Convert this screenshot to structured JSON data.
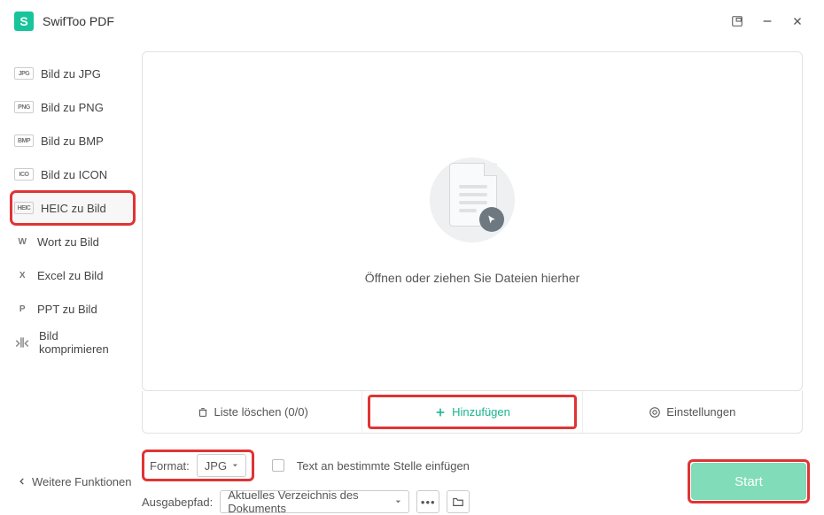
{
  "app": {
    "title": "SwifToo PDF"
  },
  "sidebar": {
    "items": [
      {
        "badge": "JPG",
        "label": "Bild zu JPG"
      },
      {
        "badge": "PNG",
        "label": "Bild zu PNG"
      },
      {
        "badge": "BMP",
        "label": "Bild zu BMP"
      },
      {
        "badge": "ICO",
        "label": "Bild zu ICON"
      },
      {
        "badge": "HEIC",
        "label": "HEIC zu Bild"
      },
      {
        "badge": "W",
        "label": "Wort zu Bild"
      },
      {
        "badge": "X",
        "label": "Excel zu Bild"
      },
      {
        "badge": "P",
        "label": "PPT zu Bild"
      },
      {
        "badge": "",
        "label": "Bild komprimieren"
      }
    ],
    "active_index": 4
  },
  "drop": {
    "text": "Öffnen oder ziehen Sie Dateien hierher"
  },
  "action_bar": {
    "clear_list": "Liste löschen (0/0)",
    "add": "Hinzufügen",
    "settings": "Einstellungen"
  },
  "footer": {
    "back": "Weitere Funktionen",
    "format_label": "Format:",
    "format_value": "JPG",
    "insert_text": "Text an bestimmte Stelle einfügen",
    "output_label": "Ausgabepfad:",
    "output_value": "Aktuelles Verzeichnis des Dokuments",
    "start": "Start"
  }
}
